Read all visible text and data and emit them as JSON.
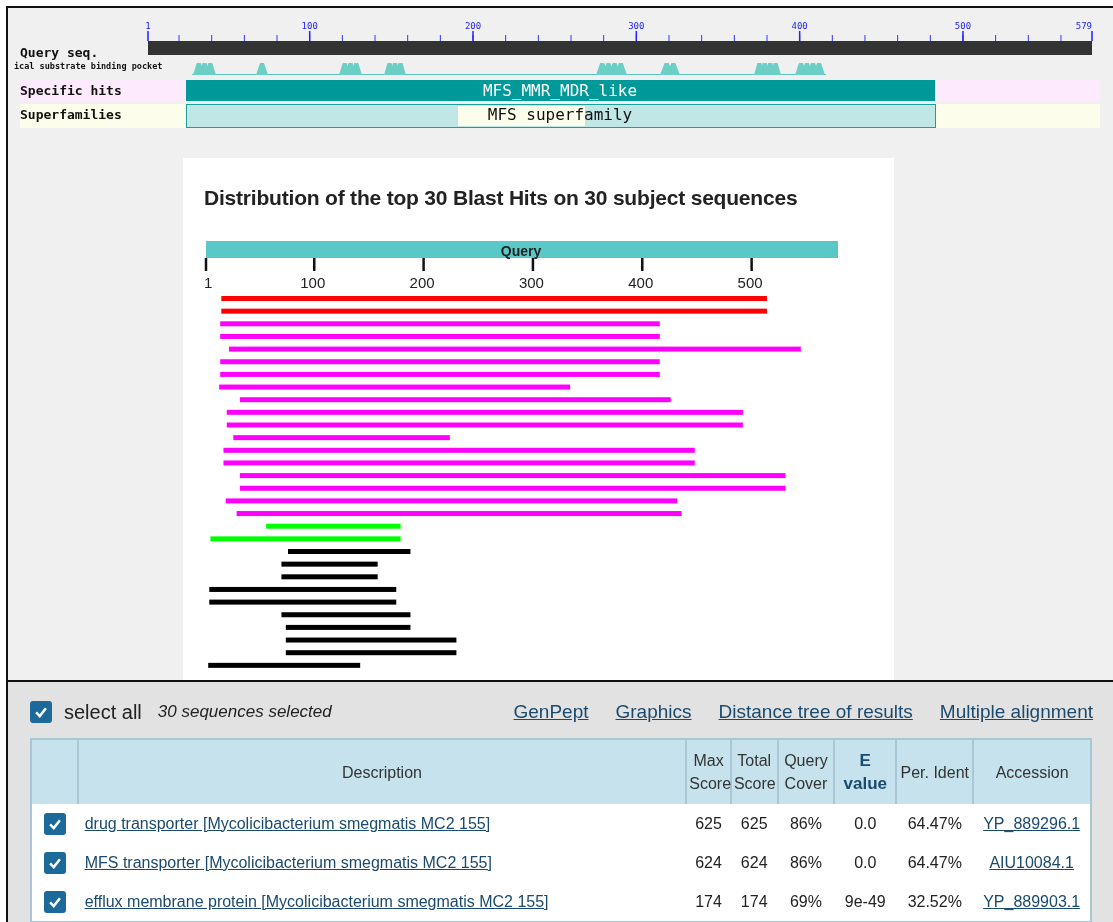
{
  "domain_graphic": {
    "ruler_labels": [
      "1",
      "100",
      "200",
      "300",
      "400",
      "500",
      "579"
    ],
    "query_label": "Query seq.",
    "feature_label": "ical substrate binding pocket",
    "rows": [
      {
        "kind": "specific",
        "label": "Specific hits",
        "hit": "MFS_MMR_MDR_like"
      },
      {
        "kind": "superfamily",
        "label": "Superfamilies",
        "hit": "MFS superfamily"
      }
    ]
  },
  "distribution": {
    "title": "Distribution of the top 30 Blast Hits on 30 subject sequences",
    "query_label": "Query",
    "axis_labels": [
      "1",
      "100",
      "200",
      "300",
      "400",
      "500"
    ],
    "hits": [
      {
        "color": "#ff0000"
      },
      {
        "color": "#ff0000"
      },
      {
        "color": "#ff00ff"
      },
      {
        "color": "#ff00ff"
      },
      {
        "color": "#ff00ff"
      },
      {
        "color": "#ff00ff"
      },
      {
        "color": "#ff00ff"
      },
      {
        "color": "#ff00ff"
      },
      {
        "color": "#ff00ff"
      },
      {
        "color": "#ff00ff"
      },
      {
        "color": "#ff00ff"
      },
      {
        "color": "#ff00ff"
      },
      {
        "color": "#ff00ff"
      },
      {
        "color": "#ff00ff"
      },
      {
        "color": "#ff00ff"
      },
      {
        "color": "#ff00ff"
      },
      {
        "color": "#ff00ff"
      },
      {
        "color": "#ff00ff"
      },
      {
        "color": "#00ff00"
      },
      {
        "color": "#00ff00"
      },
      {
        "color": "#000000"
      },
      {
        "color": "#000000"
      },
      {
        "color": "#000000"
      },
      {
        "color": "#000000"
      },
      {
        "color": "#000000"
      },
      {
        "color": "#000000"
      },
      {
        "color": "#000000"
      },
      {
        "color": "#000000"
      },
      {
        "color": "#000000"
      },
      {
        "color": "#000000"
      }
    ]
  },
  "results": {
    "select_all": {
      "label": "select all",
      "checked": true
    },
    "selection_count": "30 sequences selected",
    "links": [
      "GenPept",
      "Graphics",
      "Distance tree of results",
      "Multiple alignment"
    ],
    "table": {
      "columns": [
        {
          "label": "Description",
          "bold": false
        },
        {
          "label": "Max Score",
          "bold": false
        },
        {
          "label": "Total Score",
          "bold": false
        },
        {
          "label": "Query Cover",
          "bold": false
        },
        {
          "label": "E value",
          "bold": true
        },
        {
          "label": "Per. Ident",
          "bold": false
        },
        {
          "label": "Accession",
          "bold": false
        }
      ],
      "rows": [
        {
          "checked": true,
          "description": "drug transporter [Mycolicibacterium smegmatis MC2 155]",
          "max_score": "625",
          "total_score": "625",
          "query_cover": "86%",
          "e_value": "0.0",
          "per_ident": "64.47%",
          "accession": "YP_889296.1"
        },
        {
          "checked": true,
          "description": "MFS transporter [Mycolicibacterium smegmatis MC2 155]",
          "max_score": "624",
          "total_score": "624",
          "query_cover": "86%",
          "e_value": "0.0",
          "per_ident": "64.47%",
          "accession": "AIU10084.1"
        },
        {
          "checked": true,
          "description": "efflux membrane protein [Mycolicibacterium smegmatis MC2 155]",
          "max_score": "174",
          "total_score": "174",
          "query_cover": "69%",
          "e_value": "9e-49",
          "per_ident": "32.52%",
          "accession": "YP_889903.1"
        }
      ]
    }
  }
}
